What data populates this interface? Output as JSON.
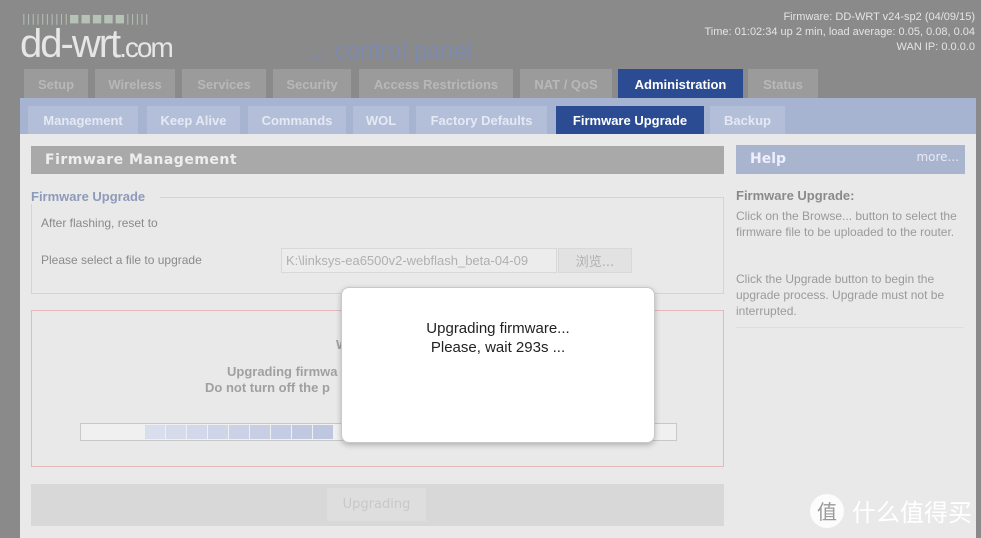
{
  "header": {
    "logo_bars": "||||||||||■■■■■|||||",
    "logo_main": "dd-wrt",
    "logo_suffix": ".com",
    "subtitle": "... control panel",
    "firmware": "Firmware: DD-WRT v24-sp2 (04/09/15)",
    "time": "Time: 01:02:34 up 2 min, load average: 0.05, 0.08, 0.04",
    "wan_ip": "WAN IP: 0.0.0.0"
  },
  "tabs": [
    "Setup",
    "Wireless",
    "Services",
    "Security",
    "Access Restrictions",
    "NAT / QoS",
    "Administration",
    "Status"
  ],
  "active_tab": "Administration",
  "subtabs": [
    "Management",
    "Keep Alive",
    "Commands",
    "WOL",
    "Factory Defaults",
    "Firmware Upgrade",
    "Backup"
  ],
  "active_subtab": "Firmware Upgrade",
  "main": {
    "section_title": "Firmware Management",
    "fieldset_legend": "Firmware Upgrade",
    "reset_label": "After flashing, reset to",
    "file_label": "Please select a file to upgrade",
    "file_value": "K:\\linksys-ea6500v2-webflash_beta-04-09",
    "browse_label": "浏览...",
    "warn_partial": "W",
    "warn_line1": "Upgrading firmwa",
    "warn_line2": "Do not turn off the p",
    "progress_percent": 44,
    "upgrade_button": "Upgrading"
  },
  "help": {
    "title": "Help",
    "more": "more...",
    "heading": "Firmware Upgrade:",
    "p1": "Click on the Browse... button to select the firmware file to be uploaded to the router.",
    "p2": "Click the Upgrade button to begin the upgrade process. Upgrade must not be interrupted."
  },
  "dialog": {
    "line1": "Upgrading firmware...",
    "line2": "Please, wait 293s ..."
  },
  "watermark": {
    "logo": "值",
    "text": "什么值得买"
  },
  "colors": {
    "accent": "#2b4c93",
    "subnav": "#a6b4d2",
    "spinner": "#3ab0d8"
  }
}
